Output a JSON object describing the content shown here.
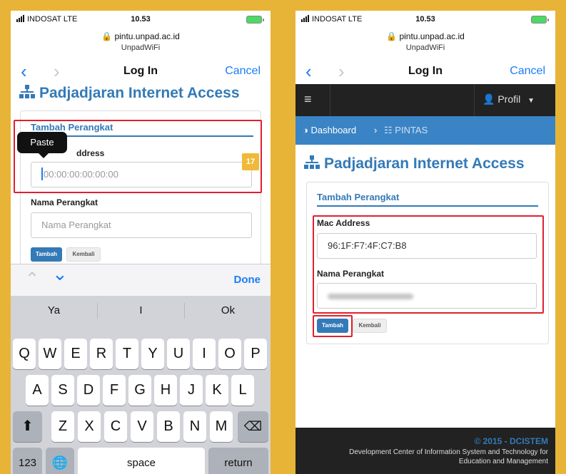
{
  "status": {
    "carrier": "INDOSAT  LTE",
    "time": "10.53"
  },
  "browser": {
    "url": "pintu.unpad.ac.id",
    "site_name": "UnpadWiFi",
    "title": "Log In",
    "cancel_label": "Cancel"
  },
  "page": {
    "title": "Padjadjaran Internet Access"
  },
  "form": {
    "heading": "Tambah Perangkat",
    "mac_label": "Mac Address",
    "mac_label_partial": "ddress",
    "mac_placeholder": "00:00:00:00:00:00",
    "mac_value": "96:1F:F7:4F:C7:B8",
    "name_label": "Nama Perangkat",
    "name_placeholder": "Nama Perangkat",
    "submit_label": "Tambah",
    "back_label": "Kembali"
  },
  "paste_label": "Paste",
  "badge_count": "17",
  "keyboard": {
    "done_label": "Done",
    "suggestions": [
      "Ya",
      "I",
      "Ok"
    ],
    "row1": [
      "Q",
      "W",
      "E",
      "R",
      "T",
      "Y",
      "U",
      "I",
      "O",
      "P"
    ],
    "row2": [
      "A",
      "S",
      "D",
      "F",
      "G",
      "H",
      "J",
      "K",
      "L"
    ],
    "row3": [
      "Z",
      "X",
      "C",
      "V",
      "B",
      "N",
      "M"
    ],
    "numbers_label": "123",
    "space_label": "space",
    "return_label": "return"
  },
  "nav": {
    "profile_label": "Profil",
    "breadcrumb_dashboard": "Dashboard",
    "breadcrumb_current": "PINTAS"
  },
  "footer": {
    "copyright": "© 2015 - DCISTEM",
    "line1": "Development Center of Information System and Technology for",
    "line2": "Education and Management"
  },
  "colors": {
    "background": "#E8B437",
    "accent": "#337AB7",
    "highlight": "#E0202E",
    "ios_blue": "#1C7CF4"
  }
}
